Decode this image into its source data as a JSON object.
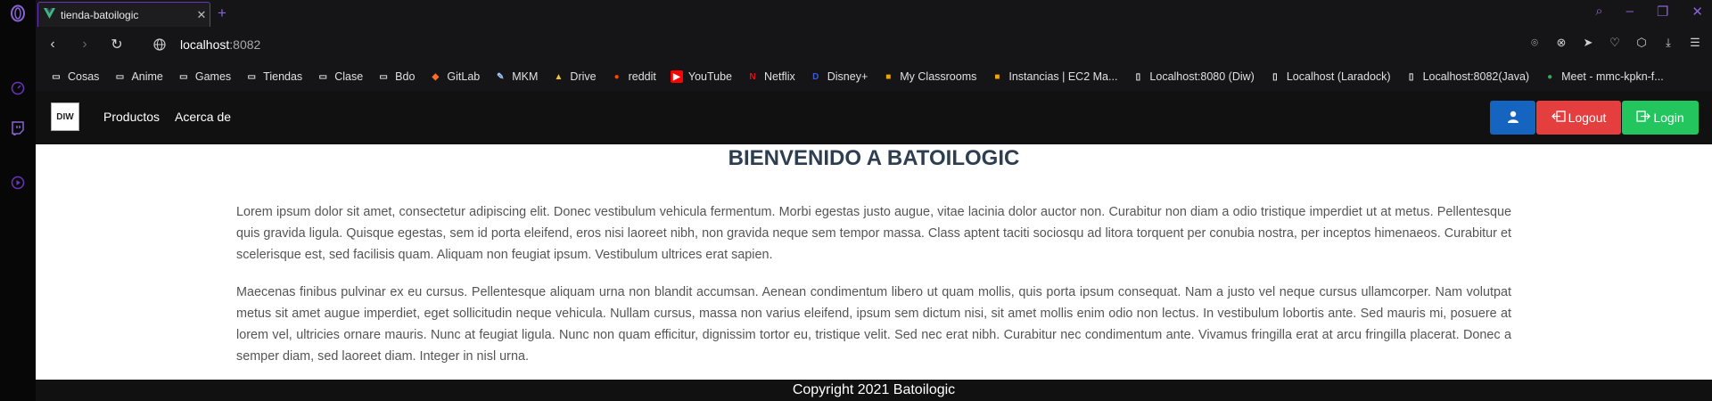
{
  "browser": {
    "tab_title": "tienda-batoilogic",
    "url_host": "localhost",
    "url_port": ":8082",
    "accent": "#6a35b8"
  },
  "bookmarks": [
    {
      "label": "Cosas",
      "icon": "folder-icon"
    },
    {
      "label": "Anime",
      "icon": "folder-icon"
    },
    {
      "label": "Games",
      "icon": "folder-icon"
    },
    {
      "label": "Tiendas",
      "icon": "folder-icon"
    },
    {
      "label": "Clase",
      "icon": "folder-icon"
    },
    {
      "label": "Bdo",
      "icon": "folder-icon"
    },
    {
      "label": "GitLab",
      "icon": "gitlab-icon"
    },
    {
      "label": "MKM",
      "icon": "mkm-icon"
    },
    {
      "label": "Drive",
      "icon": "drive-icon"
    },
    {
      "label": "reddit",
      "icon": "reddit-icon"
    },
    {
      "label": "YouTube",
      "icon": "youtube-icon"
    },
    {
      "label": "Netflix",
      "icon": "netflix-icon"
    },
    {
      "label": "Disney+",
      "icon": "disney-icon"
    },
    {
      "label": "My Classrooms",
      "icon": "aws-icon"
    },
    {
      "label": "Instancias | EC2 Ma...",
      "icon": "aws-icon"
    },
    {
      "label": "Localhost:8080 (Diw)",
      "icon": "page-icon"
    },
    {
      "label": "Localhost (Laradock)",
      "icon": "page-icon"
    },
    {
      "label": "Localhost:8082(Java)",
      "icon": "page-icon"
    },
    {
      "label": "Meet - mmc-kpkn-f...",
      "icon": "meet-icon"
    }
  ],
  "app": {
    "brand": "DIW",
    "nav": [
      "Productos",
      "Acerca de"
    ],
    "logout_label": "Logout",
    "login_label": "Login",
    "heading": "BIENVENIDO A BATOILOGIC",
    "paragraphs": [
      "Lorem ipsum dolor sit amet, consectetur adipiscing elit. Donec vestibulum vehicula fermentum. Morbi egestas justo augue, vitae lacinia dolor auctor non. Curabitur non diam a odio tristique imperdiet ut at metus. Pellentesque quis gravida ligula. Quisque egestas, sem id porta eleifend, eros nisi laoreet nibh, non gravida neque sem tempor massa. Class aptent taciti sociosqu ad litora torquent per conubia nostra, per inceptos himenaeos. Curabitur et scelerisque est, sed facilisis quam. Aliquam non feugiat ipsum. Vestibulum ultrices erat sapien.",
      "Maecenas finibus pulvinar ex eu cursus. Pellentesque aliquam urna non blandit accumsan. Aenean condimentum libero ut quam mollis, quis porta ipsum consequat. Nam a justo vel neque cursus ullamcorper. Nam volutpat metus sit amet augue imperdiet, eget sollicitudin neque vehicula. Nullam cursus, massa non varius eleifend, ipsum sem dictum nisi, sit amet mollis enim odio non lectus. In vestibulum lobortis ante. Sed mauris mi, posuere at lorem vel, ultricies ornare mauris. Nunc at feugiat ligula. Nunc non quam efficitur, dignissim tortor eu, tristique velit. Sed nec erat nibh. Curabitur nec condimentum ante. Vivamus fringilla erat at arcu fringilla placerat. Donec a semper diam, sed laoreet diam. Integer in nisl urna."
    ],
    "footer": "Copyright 2021 Batoilogic",
    "colors": {
      "user": "#1565c0",
      "logout": "#e53e3e",
      "login": "#22c55e",
      "navbar": "#111111",
      "heading": "#2c3e50"
    }
  }
}
